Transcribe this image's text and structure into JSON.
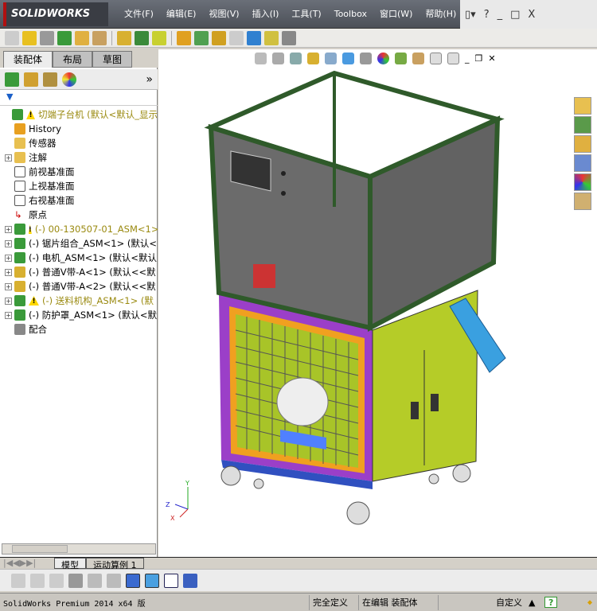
{
  "app": {
    "logo": "SOLIDWORKS"
  },
  "menu": [
    "文件(F)",
    "编辑(E)",
    "视图(V)",
    "插入(I)",
    "工具(T)",
    "Toolbox",
    "窗口(W)",
    "帮助(H)"
  ],
  "window_controls": {
    "help": "?",
    "minimize": "_",
    "restore": "□",
    "close": "X"
  },
  "left_tabs": [
    "装配体",
    "布局",
    "草图"
  ],
  "panel_expand": "»",
  "tree": [
    {
      "label": "切端子台机  (默认<默认_显示",
      "warn": true,
      "expand": false,
      "icon": "assembly",
      "olive": true
    },
    {
      "label": "History",
      "icon": "history"
    },
    {
      "label": "传感器",
      "icon": "sensor"
    },
    {
      "label": "注解",
      "icon": "annotation",
      "expand": true
    },
    {
      "label": "前视基准面",
      "icon": "plane"
    },
    {
      "label": "上视基准面",
      "icon": "plane"
    },
    {
      "label": "右视基准面",
      "icon": "plane"
    },
    {
      "label": "原点",
      "icon": "origin"
    },
    {
      "label": "(-) 00-130507-01_ASM<1>",
      "warn": true,
      "expand": true,
      "icon": "assembly",
      "olive": true
    },
    {
      "label": "(-) 锯片组合_ASM<1> (默认<",
      "expand": true,
      "icon": "assembly"
    },
    {
      "label": "(-) 电机_ASM<1> (默认<默认",
      "expand": true,
      "icon": "assembly"
    },
    {
      "label": "(-) 普通V带-A<1> (默认<<默",
      "expand": true,
      "icon": "part"
    },
    {
      "label": "(-) 普通V带-A<2> (默认<<默",
      "expand": true,
      "icon": "part"
    },
    {
      "label": "(-) 送料机构_ASM<1> (默",
      "warn": true,
      "expand": true,
      "icon": "assembly",
      "olive": true
    },
    {
      "label": "(-) 防护罩_ASM<1> (默认<默",
      "expand": true,
      "icon": "assembly"
    },
    {
      "label": "配合",
      "icon": "mates"
    }
  ],
  "bottom_tabs": [
    "模型",
    "运动算例 1"
  ],
  "status": {
    "product": "SolidWorks Premium 2014 x64 版",
    "state": "完全定义",
    "editing": "在编辑 装配体",
    "units": "自定义",
    "help": "?"
  },
  "colors": {
    "frame": "#2f5a2a",
    "panel": "#6b6b6b",
    "cabinet": "#b5cc28",
    "purple": "#9b3fc8",
    "orange": "#f0a020",
    "chute": "#3aa0e0"
  }
}
